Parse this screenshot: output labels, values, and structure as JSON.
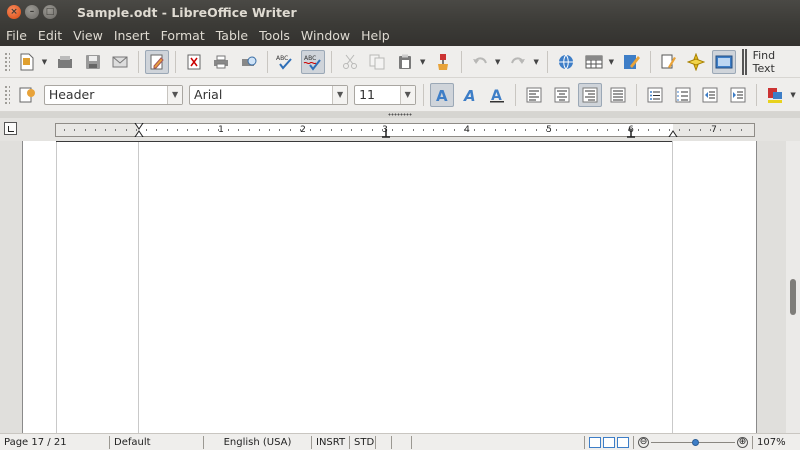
{
  "window": {
    "title": "Sample.odt - LibreOffice Writer",
    "controls": {
      "close": "×",
      "minimize": "–",
      "maximize": "□"
    }
  },
  "menubar": {
    "items": [
      {
        "id": "file",
        "label": "File"
      },
      {
        "id": "edit",
        "label": "Edit"
      },
      {
        "id": "view",
        "label": "View"
      },
      {
        "id": "insert",
        "label": "Insert"
      },
      {
        "id": "format",
        "label": "Format"
      },
      {
        "id": "table",
        "label": "Table"
      },
      {
        "id": "tools",
        "label": "Tools"
      },
      {
        "id": "window",
        "label": "Window"
      },
      {
        "id": "help",
        "label": "Help"
      }
    ]
  },
  "standard_toolbar": {
    "find_text_label": "Find Text",
    "icons": [
      "new-document-icon",
      "open-icon",
      "save-icon",
      "email-icon",
      "edit-file-icon",
      "export-pdf-icon",
      "print-icon",
      "print-preview-icon",
      "spellcheck-icon",
      "autospellcheck-icon",
      "cut-icon",
      "copy-icon",
      "paste-icon",
      "clone-formatting-icon",
      "undo-icon",
      "redo-icon",
      "hyperlink-icon",
      "table-icon",
      "show-draw-functions-icon",
      "navigator-icon",
      "gallery-icon",
      "data-sources-icon"
    ]
  },
  "formatting_toolbar": {
    "paragraph_style": "Header",
    "font_name": "Arial",
    "font_size": "11",
    "icons": [
      "styles-icon",
      "bold-icon",
      "italic-icon",
      "underline-icon",
      "align-left-icon",
      "align-center-icon",
      "align-right-icon",
      "justify-icon",
      "bullets-icon",
      "numbering-icon",
      "decrease-indent-icon",
      "increase-indent-icon",
      "highlight-color-icon"
    ]
  },
  "ruler": {
    "numbers": [
      "1",
      "2",
      "3",
      "4",
      "5",
      "6",
      "7"
    ]
  },
  "statusbar": {
    "page": "Page 17 / 21",
    "page_style": "Default",
    "language": "English (USA)",
    "insert_mode": "INSRT",
    "selection_mode": "STD",
    "zoom": "107%",
    "zoom_out": "⊖",
    "zoom_in": "⊕",
    "zoom_level_fraction": 0.55
  },
  "colors": {
    "titlebar": "#3c3b37",
    "close_button": "#e95420",
    "accent": "#3e7ec7"
  }
}
